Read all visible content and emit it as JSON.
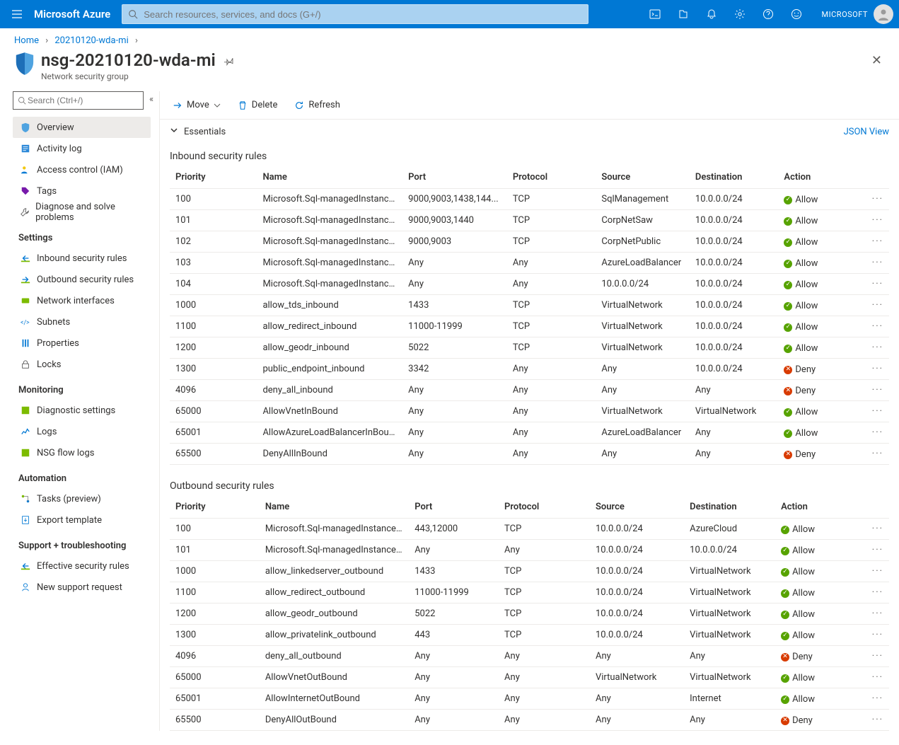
{
  "brand": "Microsoft Azure",
  "search_placeholder": "Search resources, services, and docs (G+/)",
  "account_label": "MICROSOFT",
  "breadcrumb": {
    "home": "Home",
    "parent": "20210120-wda-mi"
  },
  "page": {
    "title": "nsg-20210120-wda-mi",
    "subtitle": "Network security group"
  },
  "side_search_placeholder": "Search (Ctrl+/)",
  "side": {
    "top": [
      {
        "label": "Overview"
      },
      {
        "label": "Activity log"
      },
      {
        "label": "Access control (IAM)"
      },
      {
        "label": "Tags"
      },
      {
        "label": "Diagnose and solve problems"
      }
    ],
    "settings_hdr": "Settings",
    "settings": [
      {
        "label": "Inbound security rules"
      },
      {
        "label": "Outbound security rules"
      },
      {
        "label": "Network interfaces"
      },
      {
        "label": "Subnets"
      },
      {
        "label": "Properties"
      },
      {
        "label": "Locks"
      }
    ],
    "monitoring_hdr": "Monitoring",
    "monitoring": [
      {
        "label": "Diagnostic settings"
      },
      {
        "label": "Logs"
      },
      {
        "label": "NSG flow logs"
      }
    ],
    "automation_hdr": "Automation",
    "automation": [
      {
        "label": "Tasks (preview)"
      },
      {
        "label": "Export template"
      }
    ],
    "support_hdr": "Support + troubleshooting",
    "support": [
      {
        "label": "Effective security rules"
      },
      {
        "label": "New support request"
      }
    ]
  },
  "toolbar": {
    "move": "Move",
    "delete": "Delete",
    "refresh": "Refresh"
  },
  "essentials": {
    "label": "Essentials",
    "json": "JSON View"
  },
  "cols": {
    "priority": "Priority",
    "name": "Name",
    "port": "Port",
    "protocol": "Protocol",
    "source": "Source",
    "destination": "Destination",
    "action": "Action"
  },
  "sec_inbound_title": "Inbound security rules",
  "sec_outbound_title": "Outbound security rules",
  "inbound": [
    {
      "priority": "100",
      "name": "Microsoft.Sql-managedInstances_U...",
      "port": "9000,9003,1438,144...",
      "protocol": "TCP",
      "source": "SqlManagement",
      "destination": "10.0.0.0/24",
      "action": "Allow"
    },
    {
      "priority": "101",
      "name": "Microsoft.Sql-managedInstances_U...",
      "port": "9000,9003,1440",
      "protocol": "TCP",
      "source": "CorpNetSaw",
      "destination": "10.0.0.0/24",
      "action": "Allow"
    },
    {
      "priority": "102",
      "name": "Microsoft.Sql-managedInstances_U...",
      "port": "9000,9003",
      "protocol": "TCP",
      "source": "CorpNetPublic",
      "destination": "10.0.0.0/24",
      "action": "Allow"
    },
    {
      "priority": "103",
      "name": "Microsoft.Sql-managedInstances_U...",
      "port": "Any",
      "protocol": "Any",
      "source": "AzureLoadBalancer",
      "destination": "10.0.0.0/24",
      "action": "Allow"
    },
    {
      "priority": "104",
      "name": "Microsoft.Sql-managedInstances_U...",
      "port": "Any",
      "protocol": "Any",
      "source": "10.0.0.0/24",
      "destination": "10.0.0.0/24",
      "action": "Allow"
    },
    {
      "priority": "1000",
      "name": "allow_tds_inbound",
      "port": "1433",
      "protocol": "TCP",
      "source": "VirtualNetwork",
      "destination": "10.0.0.0/24",
      "action": "Allow"
    },
    {
      "priority": "1100",
      "name": "allow_redirect_inbound",
      "port": "11000-11999",
      "protocol": "TCP",
      "source": "VirtualNetwork",
      "destination": "10.0.0.0/24",
      "action": "Allow"
    },
    {
      "priority": "1200",
      "name": "allow_geodr_inbound",
      "port": "5022",
      "protocol": "TCP",
      "source": "VirtualNetwork",
      "destination": "10.0.0.0/24",
      "action": "Allow"
    },
    {
      "priority": "1300",
      "name": "public_endpoint_inbound",
      "port": "3342",
      "protocol": "Any",
      "source": "Any",
      "destination": "10.0.0.0/24",
      "action": "Deny"
    },
    {
      "priority": "4096",
      "name": "deny_all_inbound",
      "port": "Any",
      "protocol": "Any",
      "source": "Any",
      "destination": "Any",
      "action": "Deny"
    },
    {
      "priority": "65000",
      "name": "AllowVnetInBound",
      "port": "Any",
      "protocol": "Any",
      "source": "VirtualNetwork",
      "destination": "VirtualNetwork",
      "action": "Allow"
    },
    {
      "priority": "65001",
      "name": "AllowAzureLoadBalancerInBound",
      "port": "Any",
      "protocol": "Any",
      "source": "AzureLoadBalancer",
      "destination": "Any",
      "action": "Allow"
    },
    {
      "priority": "65500",
      "name": "DenyAllInBound",
      "port": "Any",
      "protocol": "Any",
      "source": "Any",
      "destination": "Any",
      "action": "Deny"
    }
  ],
  "outbound": [
    {
      "priority": "100",
      "name": "Microsoft.Sql-managedInstances_U...",
      "port": "443,12000",
      "protocol": "TCP",
      "source": "10.0.0.0/24",
      "destination": "AzureCloud",
      "action": "Allow"
    },
    {
      "priority": "101",
      "name": "Microsoft.Sql-managedInstances_U...",
      "port": "Any",
      "protocol": "Any",
      "source": "10.0.0.0/24",
      "destination": "10.0.0.0/24",
      "action": "Allow"
    },
    {
      "priority": "1000",
      "name": "allow_linkedserver_outbound",
      "port": "1433",
      "protocol": "TCP",
      "source": "10.0.0.0/24",
      "destination": "VirtualNetwork",
      "action": "Allow"
    },
    {
      "priority": "1100",
      "name": "allow_redirect_outbound",
      "port": "11000-11999",
      "protocol": "TCP",
      "source": "10.0.0.0/24",
      "destination": "VirtualNetwork",
      "action": "Allow"
    },
    {
      "priority": "1200",
      "name": "allow_geodr_outbound",
      "port": "5022",
      "protocol": "TCP",
      "source": "10.0.0.0/24",
      "destination": "VirtualNetwork",
      "action": "Allow"
    },
    {
      "priority": "1300",
      "name": "allow_privatelink_outbound",
      "port": "443",
      "protocol": "TCP",
      "source": "10.0.0.0/24",
      "destination": "VirtualNetwork",
      "action": "Allow"
    },
    {
      "priority": "4096",
      "name": "deny_all_outbound",
      "port": "Any",
      "protocol": "Any",
      "source": "Any",
      "destination": "Any",
      "action": "Deny"
    },
    {
      "priority": "65000",
      "name": "AllowVnetOutBound",
      "port": "Any",
      "protocol": "Any",
      "source": "VirtualNetwork",
      "destination": "VirtualNetwork",
      "action": "Allow"
    },
    {
      "priority": "65001",
      "name": "AllowInternetOutBound",
      "port": "Any",
      "protocol": "Any",
      "source": "Any",
      "destination": "Internet",
      "action": "Allow"
    },
    {
      "priority": "65500",
      "name": "DenyAllOutBound",
      "port": "Any",
      "protocol": "Any",
      "source": "Any",
      "destination": "Any",
      "action": "Deny"
    }
  ]
}
